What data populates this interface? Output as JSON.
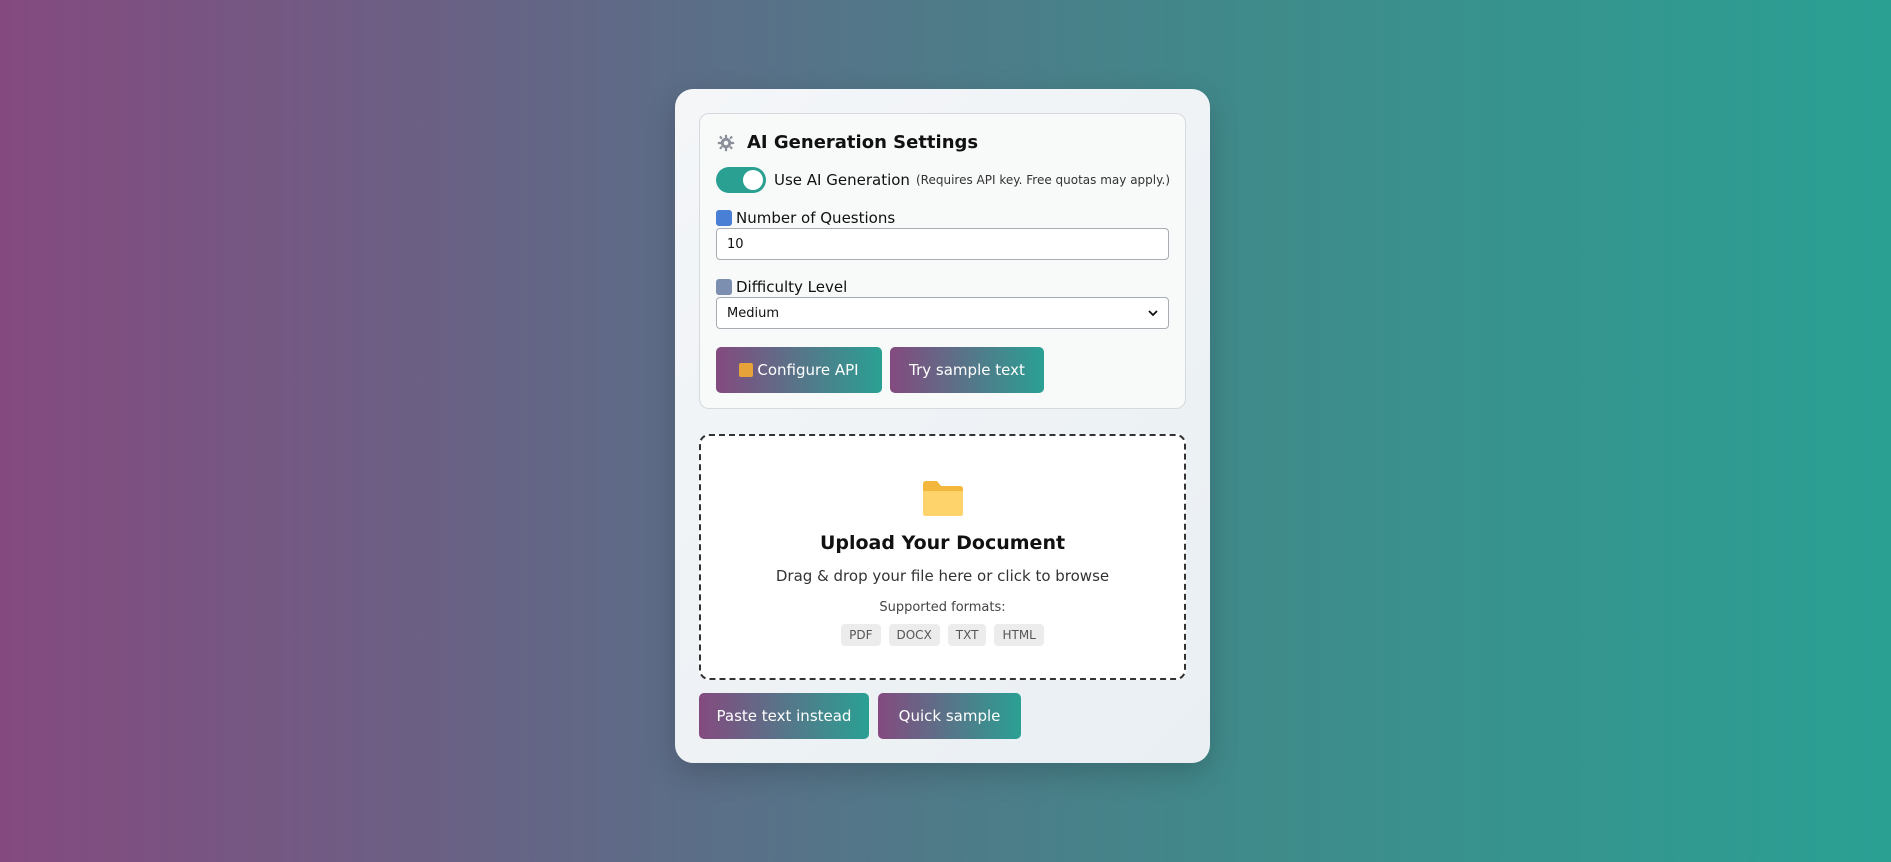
{
  "settings": {
    "title": "AI Generation Settings",
    "toggle_label": "Use AI Generation",
    "toggle_on": true,
    "toggle_note": "(Requires API key. Free quotas may apply.)",
    "questions_label": "Number of Questions",
    "questions_value": "10",
    "difficulty_label": "Difficulty Level",
    "difficulty_value": "Medium",
    "configure_api_label": "Configure API",
    "sample_text_label": "Try sample text"
  },
  "upload": {
    "title": "Upload Your Document",
    "subtitle": "Drag & drop your file here or click to browse",
    "formats_label": "Supported formats:",
    "formats": [
      "PDF",
      "DOCX",
      "TXT",
      "HTML"
    ]
  },
  "actions": {
    "paste_label": "Paste text instead",
    "quick_sample_label": "Quick sample"
  },
  "colors": {
    "accent_start": "#844a7f",
    "accent_end": "#2aa093",
    "toggle": "#2aa093"
  },
  "icons": {
    "settings": "gear-icon",
    "questions": "numbers-icon",
    "difficulty": "difficulty-icon",
    "configure": "lock-icon",
    "upload": "folder-icon",
    "select": "chevron-down-icon"
  }
}
